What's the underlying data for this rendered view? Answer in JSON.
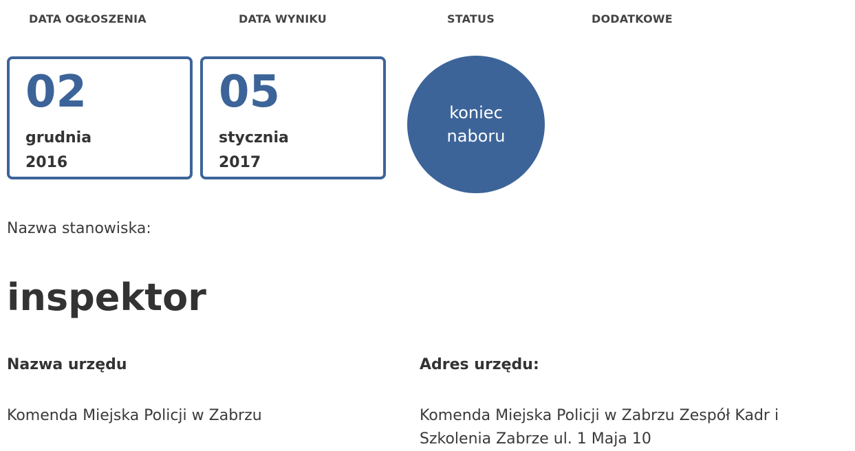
{
  "columns": {
    "announcement_date": "DATA OGŁOSZENIA",
    "result_date": "DATA WYNIKU",
    "status": "STATUS",
    "additional": "DODATKOWE"
  },
  "announcement": {
    "day": "02",
    "month": "grudnia",
    "year": "2016"
  },
  "result": {
    "day": "05",
    "month": "stycznia",
    "year": "2017"
  },
  "status": {
    "line1": "koniec",
    "line2": "naboru"
  },
  "position": {
    "label": "Nazwa stanowiska:",
    "title": "inspektor"
  },
  "office": {
    "name_label": "Nazwa urzędu",
    "name_value": "Komenda Miejska Policji w Zabrzu",
    "address_label": "Adres urzędu:",
    "address_line1": "Komenda Miejska Policji w Zabrzu Zespół Kadr i",
    "address_line2": "Szkolenia Zabrze ul. 1 Maja 10"
  },
  "colors": {
    "accent": "#3c6499",
    "text": "#3a3a3a"
  }
}
